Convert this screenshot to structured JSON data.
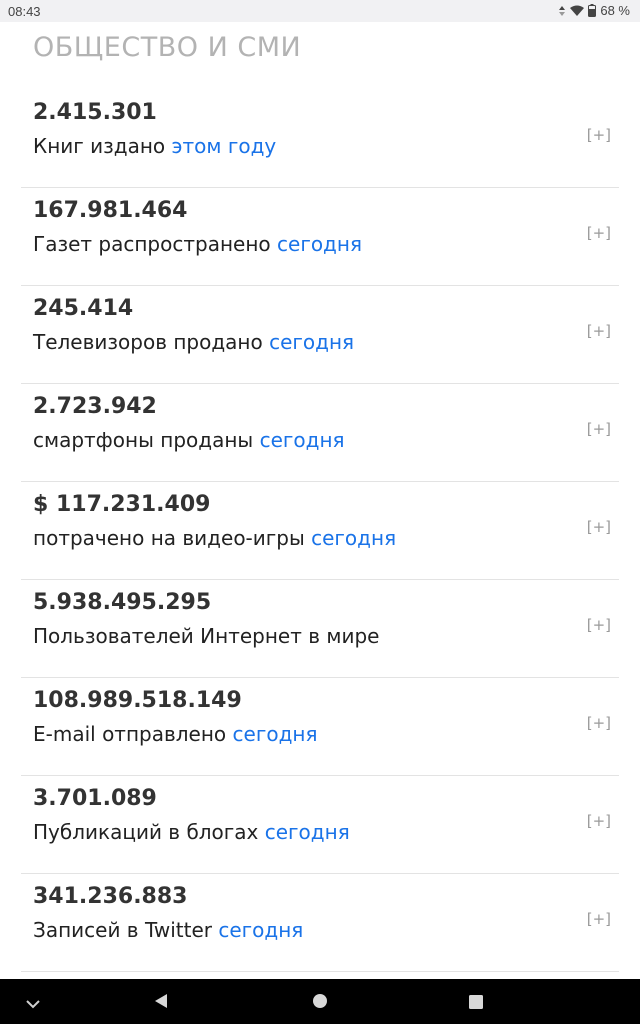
{
  "status_bar": {
    "time": "08:43",
    "battery": "68 %",
    "icons": [
      "data-arrows-icon",
      "wifi-icon",
      "battery-icon"
    ]
  },
  "section": {
    "title": "ОБЩЕСТВО И СМИ"
  },
  "items": [
    {
      "value": "2.415.301",
      "label": "Книг издано",
      "link": "этом году",
      "expand": "[+]"
    },
    {
      "value": "167.981.464",
      "label": "Газет распространено",
      "link": "сегодня",
      "expand": "[+]"
    },
    {
      "value": "245.414",
      "label": "Телевизоров продано",
      "link": "сегодня",
      "expand": "[+]"
    },
    {
      "value": "2.723.942",
      "label": "смартфоны проданы",
      "link": "сегодня",
      "expand": "[+]"
    },
    {
      "value": "$ 117.231.409",
      "label": "потрачено на видео-игры",
      "link": "сегодня",
      "expand": "[+]"
    },
    {
      "value": "5.938.495.295",
      "label": "Пользователей Интернет в мире",
      "link": "",
      "expand": "[+]"
    },
    {
      "value": "108.989.518.149",
      "label": "E-mail отправлено",
      "link": "сегодня",
      "expand": "[+]"
    },
    {
      "value": "3.701.089",
      "label": "Публикаций в блогах",
      "link": "сегодня",
      "expand": "[+]"
    },
    {
      "value": "341.236.883",
      "label": "Записей в Twitter",
      "link": "сегодня",
      "expand": "[+]"
    }
  ],
  "nav_bar": {
    "buttons": [
      "chevron-down-icon",
      "back-icon",
      "home-icon",
      "recents-icon"
    ]
  },
  "colors": {
    "link": "#1a73e8",
    "title": "#b3b3b3",
    "value": "#333333",
    "divider": "#e3e3e3"
  }
}
